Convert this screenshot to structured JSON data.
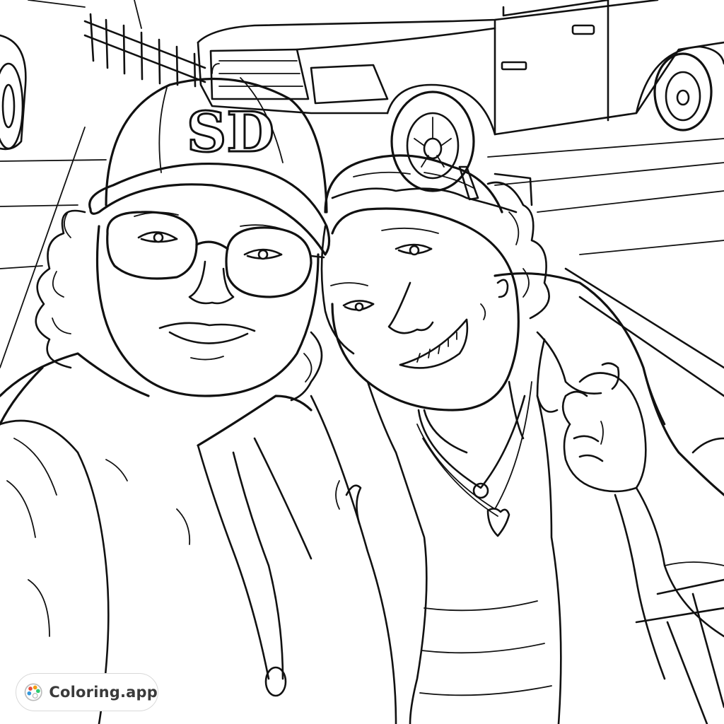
{
  "image": {
    "subject": "coloring-page",
    "cap_logo_text": "SD"
  },
  "watermark": {
    "text": "Coloring.app",
    "icon": "palette-icon",
    "colors": {
      "red": "#e74c3c",
      "orange": "#f39c12",
      "green": "#2ecc71",
      "blue": "#3498db",
      "border": "#d9d9d9",
      "text": "#3a3a3a"
    }
  }
}
